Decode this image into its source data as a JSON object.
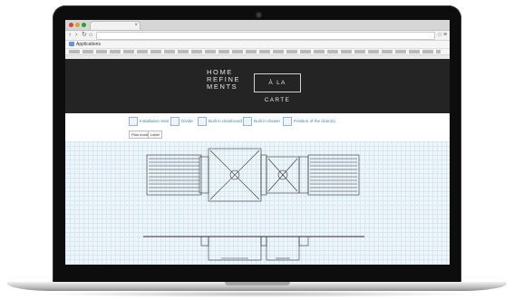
{
  "browser": {
    "apps_label": "Applications"
  },
  "site": {
    "logo_line1": "HOME",
    "logo_line2": "REFINE",
    "logo_line3": "MENTS",
    "logo_badge": "À LA CARTE"
  },
  "options": [
    {
      "label": "Installation seat",
      "icon": "seat-icon"
    },
    {
      "label": "Divide",
      "icon": "divide-icon"
    },
    {
      "label": "Built in drainboard",
      "icon": "drainboard-icon"
    },
    {
      "label": "Built in drawer",
      "icon": "drawer-icon"
    },
    {
      "label": "Position of the drain(s)",
      "icon": "drain-icon"
    }
  ],
  "buttons": {
    "first": "Plan mode",
    "second": "Label"
  },
  "colors": {
    "header_bg": "#242424",
    "accent": "#3f8ab0",
    "canvas_bg": "#eef6fb",
    "grid": "#d7e7f2"
  }
}
